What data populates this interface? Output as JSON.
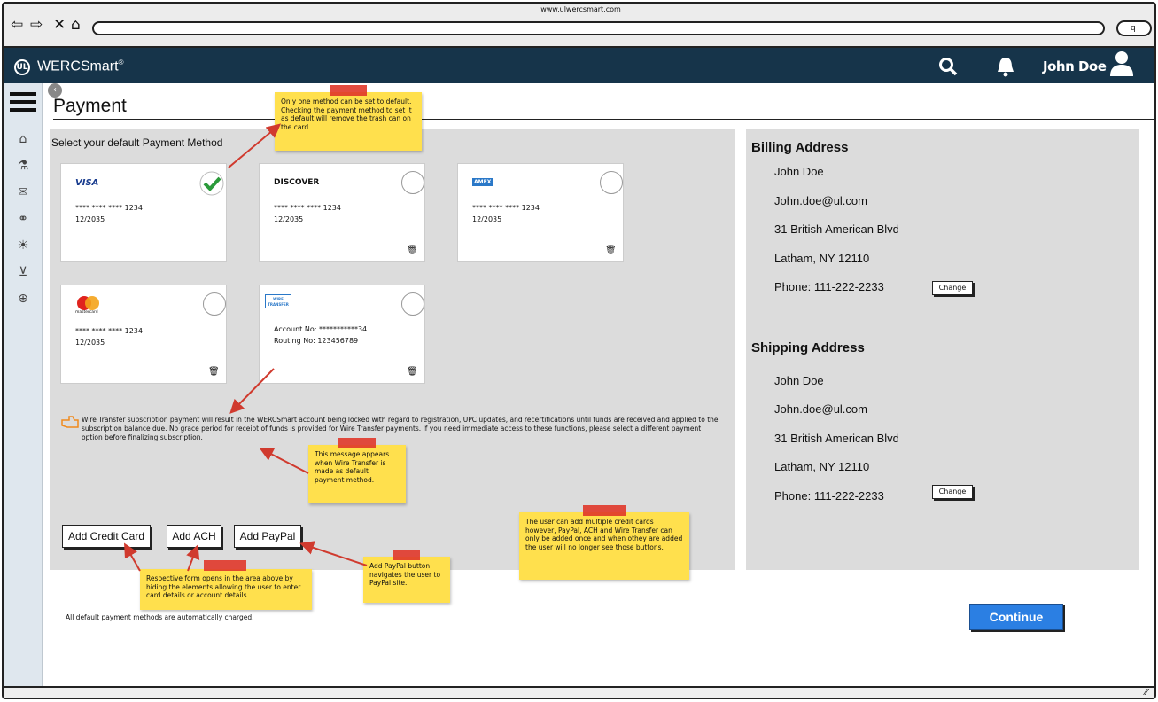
{
  "browser": {
    "url": "www.ulwercsmart.com",
    "search_glyph": "q"
  },
  "header": {
    "brand": "WERCSmart",
    "brand_tm": "®",
    "logo_text": "UL",
    "user_name": "John Doe"
  },
  "page": {
    "title": "Payment",
    "subtitle": "Select your default Payment Method"
  },
  "cards": [
    {
      "brand": "VISA",
      "number": "****  ****  ****  1234",
      "expiry": "12/2035",
      "default": true
    },
    {
      "brand": "DISCOVER",
      "number": "****  ****  ****  1234",
      "expiry": "12/2035",
      "default": false
    },
    {
      "brand": "AMEX",
      "number": "****  ****  ****  1234",
      "expiry": "12/2035",
      "default": false
    },
    {
      "brand": "mastercard",
      "number": "****  ****  ****  1234",
      "expiry": "12/2035",
      "default": false
    },
    {
      "brand": "WIRE TRANSFER",
      "account": "Account No: ***********34",
      "routing": "Routing No: 123456789",
      "default": false
    }
  ],
  "warning": "Wire Transfer subscription payment will result in the WERCSmart account being locked with regard to registration, UPC updates, and recertifications until funds are received and applied to the subscription balance due. No grace period for receipt of funds is provided for Wire Transfer payments. If you need immediate access to these functions, please select a different payment option before finalizing subscription.",
  "buttons": {
    "add_credit_card": "Add Credit Card",
    "add_ach": "Add ACH",
    "add_paypal": "Add PayPal",
    "continue": "Continue",
    "change": "Change"
  },
  "footer_note": "All default payment methods are automatically charged.",
  "billing": {
    "heading": "Billing Address",
    "name": "John Doe",
    "email": "John.doe@ul.com",
    "street": "31 British American Blvd",
    "city": "Latham, NY 12110",
    "phone": "Phone: 111-222-2233"
  },
  "shipping": {
    "heading": "Shipping Address",
    "name": "John Doe",
    "email": "John.doe@ul.com",
    "street": "31 British American Blvd",
    "city": "Latham, NY 12110",
    "phone": "Phone: 111-222-2233"
  },
  "notes": {
    "default_method": "Only one method can be set to default. Checking the payment method to set it as default will remove the trash can on the card.",
    "wire_message": "This message appears when Wire Transfer is made as default payment method.",
    "form_opens": "Respective form opens in the area above by hiding the elements allowing the user to enter card details or account details.",
    "paypal_button": "Add PayPal  button navigates the user to PayPal site.",
    "multiple_cards": "The user can add multiple credit cards however, PayPal, ACH and Wire Transfer can only be added once and when othey are added the user will no longer see those buttons."
  },
  "colors": {
    "topbar": "#16344a",
    "accent": "#2b7fe3",
    "sticky": "#ffe04d",
    "pin": "#e0372a",
    "arrow": "#d03a2e",
    "check": "#2a9a3a"
  },
  "icons": [
    "home-icon",
    "flask-icon",
    "mail-icon",
    "handshake-icon",
    "lightbulb-icon",
    "cart-icon",
    "lifebuoy-icon",
    "search-icon",
    "bell-icon",
    "user-icon",
    "trash-icon",
    "hand-point-icon"
  ]
}
